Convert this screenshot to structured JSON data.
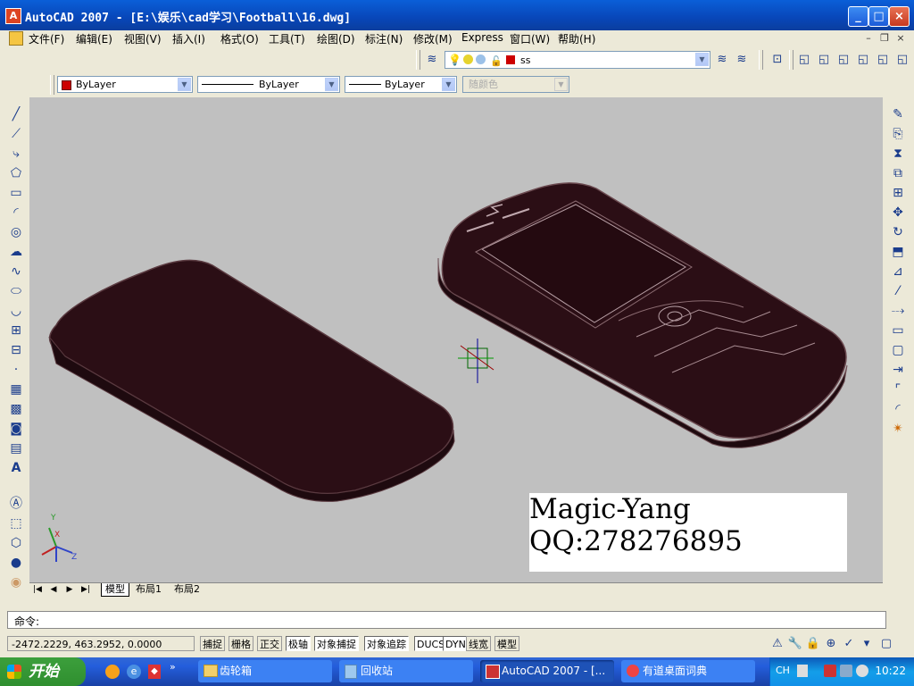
{
  "window": {
    "title": "AutoCAD 2007 - [E:\\娱乐\\cad学习\\Football\\16.dwg]",
    "min": "_",
    "max": "□",
    "close": "×"
  },
  "menu": [
    "文件(F)",
    "编辑(E)",
    "视图(V)",
    "插入(I)",
    "格式(O)",
    "工具(T)",
    "绘图(D)",
    "标注(N)",
    "修改(M)",
    "Express",
    "窗口(W)",
    "帮助(H)"
  ],
  "layer": {
    "name": "ss"
  },
  "properties": {
    "color": "ByLayer",
    "linetype": "ByLayer",
    "lineweight": "ByLayer",
    "plotstyle": "随颜色"
  },
  "layout_tabs": [
    "模型",
    "布局1",
    "布局2"
  ],
  "watermark": {
    "line1": "Magic-Yang",
    "line2": "QQ:278276895"
  },
  "command": {
    "prompt": "命令:"
  },
  "status": {
    "coords": "-2472.2229, 463.2952, 0.0000",
    "buttons": [
      "捕捉",
      "栅格",
      "正交",
      "极轴",
      "对象捕捉",
      "对象追踪",
      "DUCS",
      "DYN",
      "线宽",
      "模型"
    ]
  },
  "taskbar": {
    "start": "开始",
    "tasks": [
      "齿轮箱",
      "回收站",
      "AutoCAD 2007 - [...",
      "有道桌面词典"
    ],
    "ime": "CH",
    "clock": "10:22"
  },
  "ucs": {
    "x": "X",
    "y": "Y",
    "z": "Z"
  }
}
